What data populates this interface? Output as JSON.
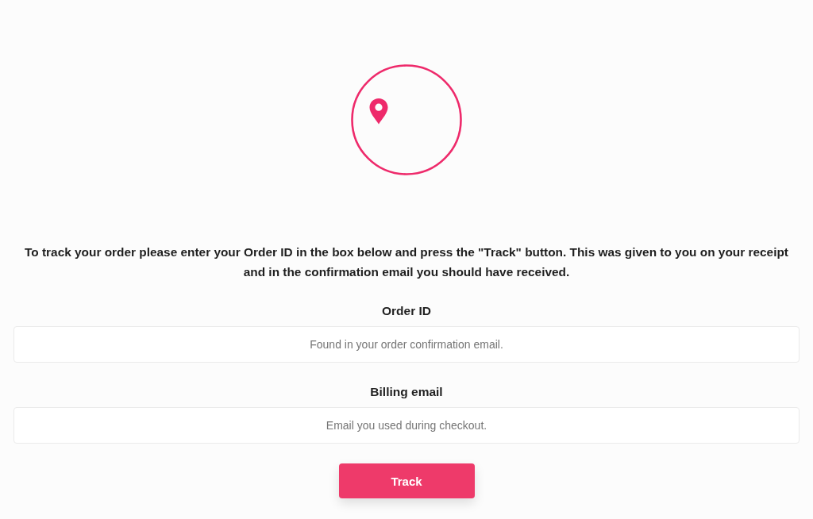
{
  "instructions": "To track your order please enter your Order ID in the box below and press the \"Track\" button. This was given to you on your receipt and in the confirmation email you should have received.",
  "fields": [
    {
      "label": "Order ID",
      "placeholder": "Found in your order confirmation email."
    },
    {
      "label": "Billing email",
      "placeholder": "Email you used during checkout."
    }
  ],
  "button": "Track"
}
